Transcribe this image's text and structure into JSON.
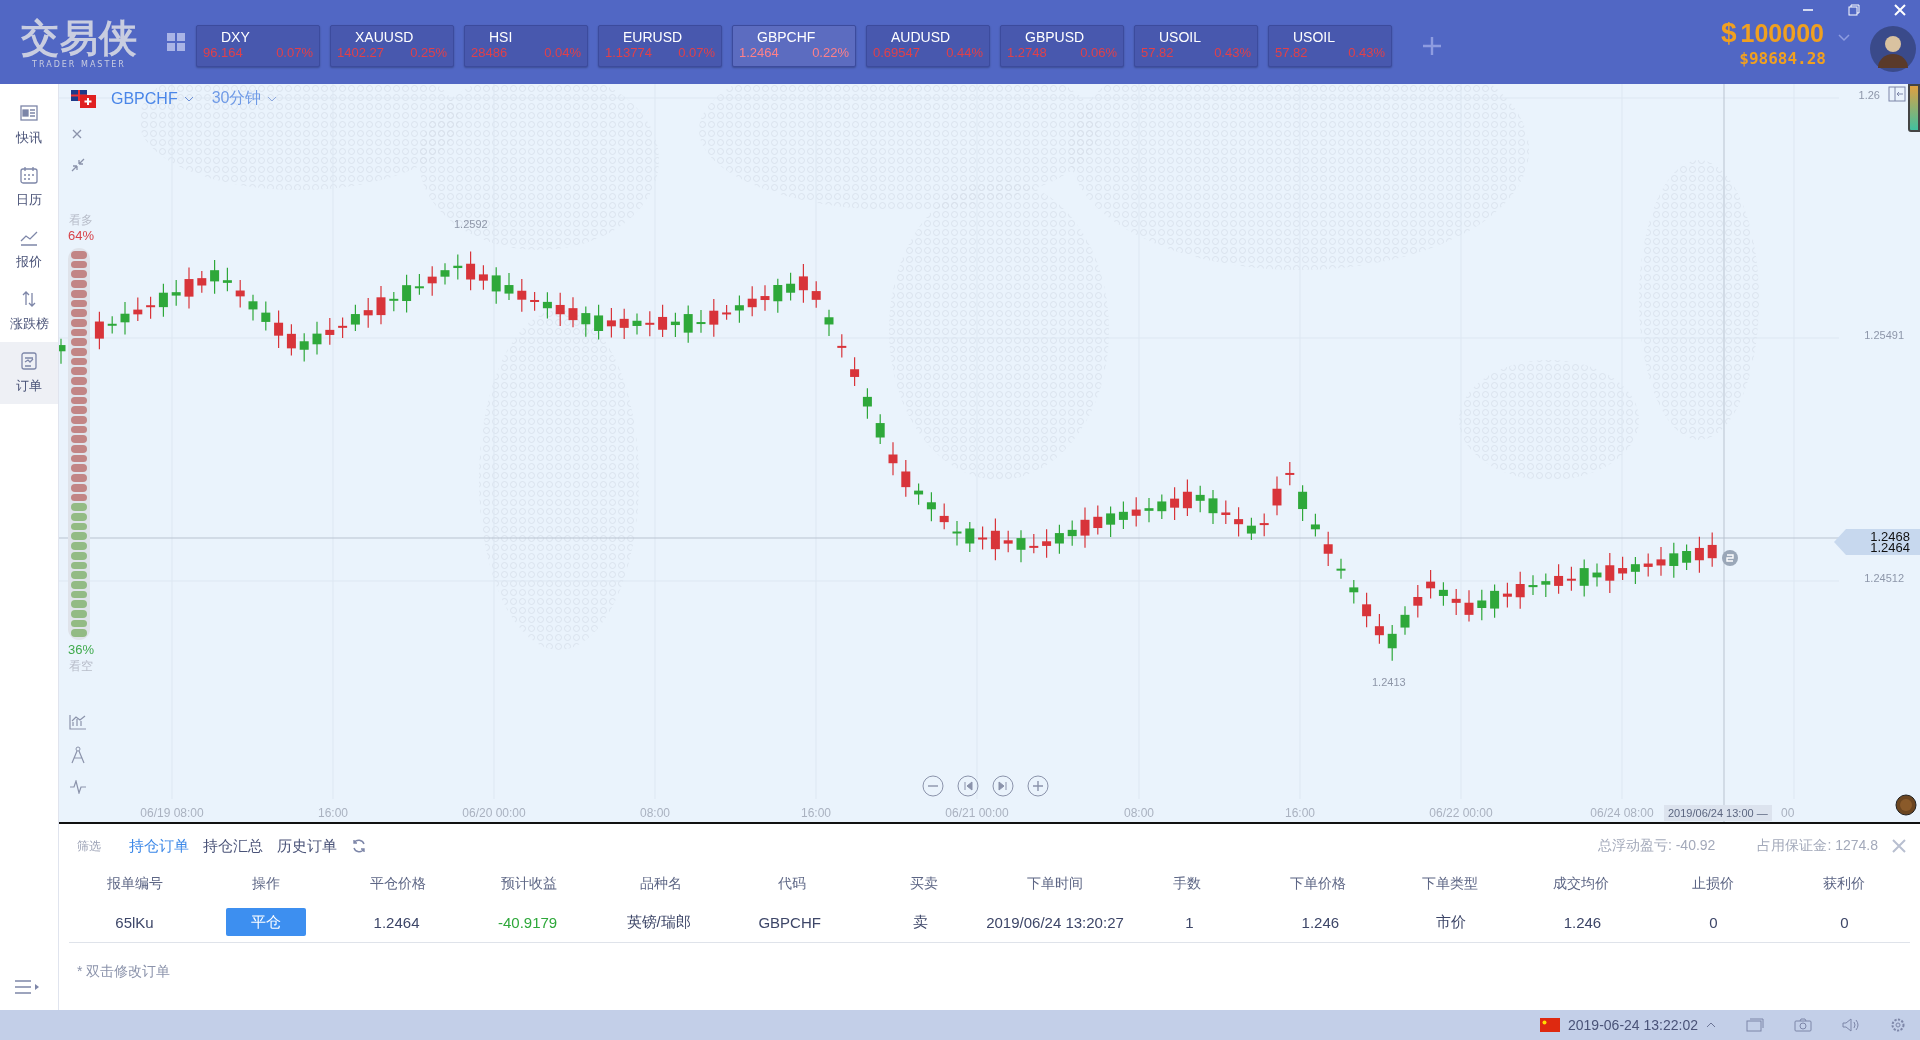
{
  "app": {
    "logo": "交易侠",
    "logo_subtitle": "TRADER MASTER"
  },
  "tickers": [
    {
      "symbol": "DXY",
      "price": "96.164",
      "change": "0.07%",
      "selected": false
    },
    {
      "symbol": "XAUUSD",
      "price": "1402.27",
      "change": "0.25%",
      "selected": false
    },
    {
      "symbol": "HSI",
      "price": "28486",
      "change": "0.04%",
      "selected": false
    },
    {
      "symbol": "EURUSD",
      "price": "1.13774",
      "change": "0.07%",
      "selected": false
    },
    {
      "symbol": "GBPCHF",
      "price": "1.2464",
      "change": "0.22%",
      "selected": true
    },
    {
      "symbol": "AUDUSD",
      "price": "0.69547",
      "change": "0.44%",
      "selected": false
    },
    {
      "symbol": "GBPUSD",
      "price": "1.2748",
      "change": "0.06%",
      "selected": false
    },
    {
      "symbol": "USOIL",
      "price": "57.82",
      "change": "0.43%",
      "selected": false
    },
    {
      "symbol": "USOIL",
      "price": "57.82",
      "change": "0.43%",
      "selected": false
    }
  ],
  "account": {
    "currency": "$",
    "balance": "100000",
    "equity": "$98684.28"
  },
  "sidebar": {
    "items": [
      {
        "label": "快讯",
        "kind": "news",
        "selected": false
      },
      {
        "label": "日历",
        "kind": "calendar",
        "selected": false
      },
      {
        "label": "报价",
        "kind": "quote",
        "selected": false
      },
      {
        "label": "涨跌榜",
        "kind": "ranking",
        "selected": false
      },
      {
        "label": "订单",
        "kind": "orders",
        "selected": true
      }
    ]
  },
  "chart": {
    "symbol": "GBPCHF",
    "timeframe": "30分钟",
    "sentiment": {
      "bull_label": "看多",
      "bull_percent": "64%",
      "bear_percent": "36%",
      "bear_label": "看空",
      "level": 0.64
    },
    "y_ticks": [
      "1.26",
      "1.25491",
      "1.24512"
    ],
    "high_label": "1.2592",
    "low_label": "1.2413",
    "price_tags": [
      "1.2468",
      "1.2464"
    ],
    "x_labels": [
      "06/19 08:00",
      "16:00",
      "06/20 00:00",
      "08:00",
      "16:00",
      "06/21 00:00",
      "08:00",
      "16:00",
      "06/22 00:00",
      "06/24 08:00",
      "00"
    ],
    "crosshair_time": "2019/06/24 13:00 —"
  },
  "orders": {
    "filter_label": "筛选",
    "tabs": [
      {
        "label": "持仓订单",
        "selected": true
      },
      {
        "label": "持仓汇总",
        "selected": false
      },
      {
        "label": "历史订单",
        "selected": false
      }
    ],
    "floating_pnl": "总浮动盈亏: -40.92",
    "margin": "占用保证金: 1274.8",
    "columns": [
      "报单编号",
      "操作",
      "平仓价格",
      "预计收益",
      "品种名",
      "代码",
      "买卖",
      "下单时间",
      "手数",
      "下单价格",
      "下单类型",
      "成交均价",
      "止损价",
      "获利价"
    ],
    "rows": [
      {
        "cells": [
          {
            "kind": "text",
            "text": "65lKu"
          },
          {
            "kind": "button",
            "text": "平仓"
          },
          {
            "kind": "text",
            "text": "1.2464"
          },
          {
            "kind": "loss",
            "text": "-40.9179"
          },
          {
            "kind": "text",
            "text": "英镑/瑞郎"
          },
          {
            "kind": "text",
            "text": "GBPCHF"
          },
          {
            "kind": "text",
            "text": "卖"
          },
          {
            "kind": "text",
            "text": "2019/06/24 13:20:27"
          },
          {
            "kind": "text",
            "text": "1"
          },
          {
            "kind": "text",
            "text": "1.246"
          },
          {
            "kind": "text",
            "text": "市价"
          },
          {
            "kind": "text",
            "text": "1.246"
          },
          {
            "kind": "text",
            "text": "0"
          },
          {
            "kind": "text",
            "text": "0"
          }
        ]
      }
    ],
    "note": "* 双击修改订单"
  },
  "status_bar": {
    "datetime": "2019-06-24 13:22:02"
  }
}
